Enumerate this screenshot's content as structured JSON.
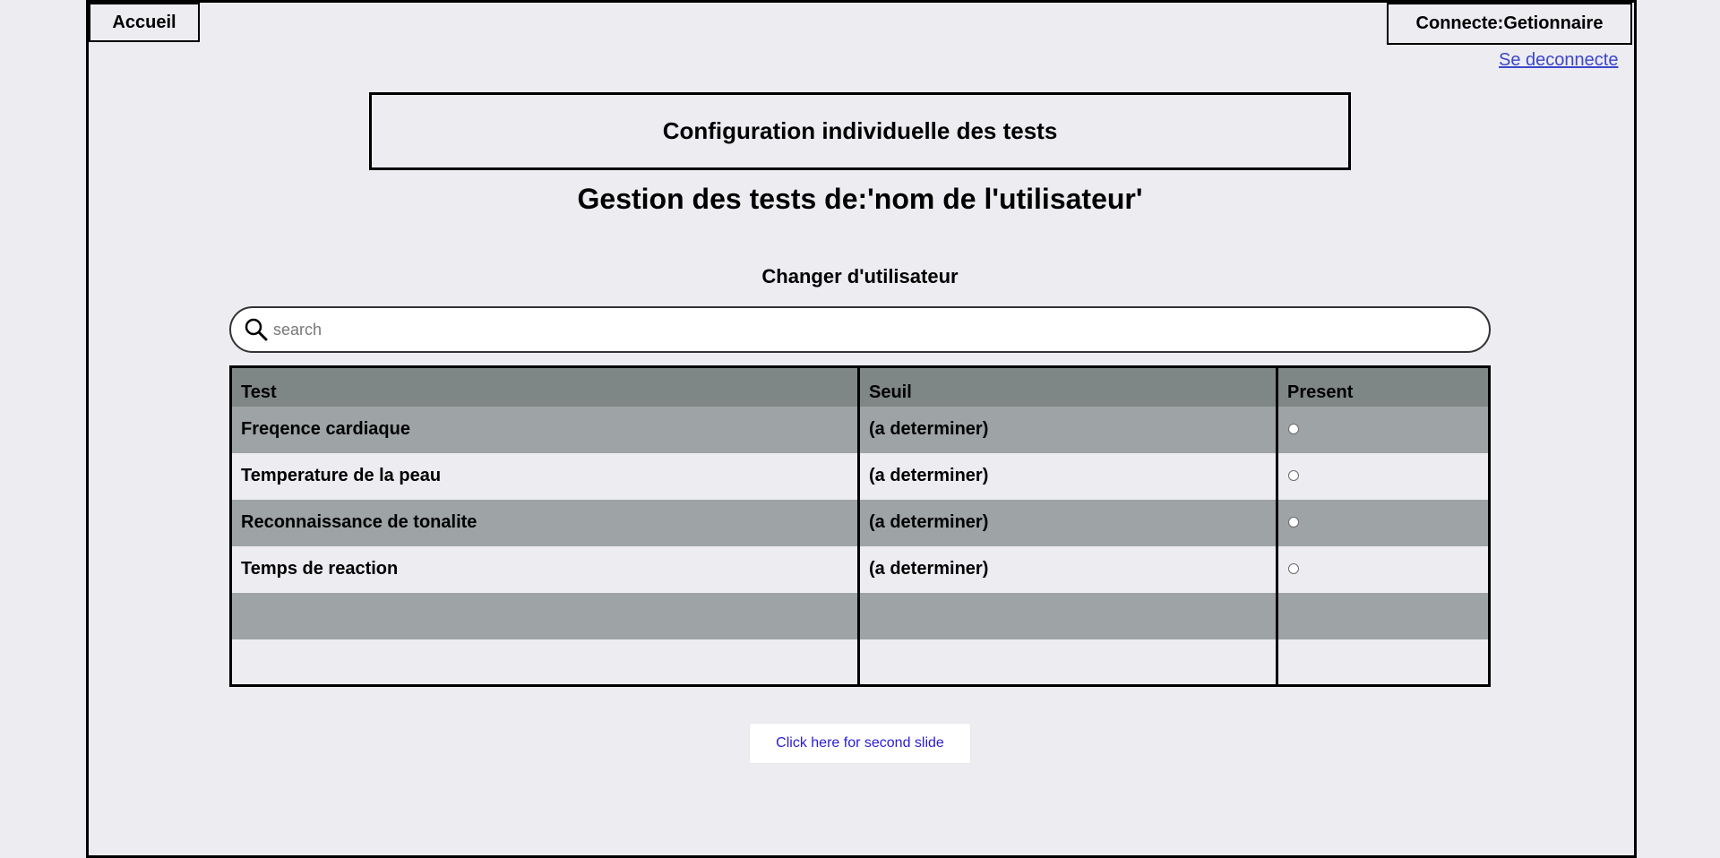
{
  "header": {
    "home_label": "Accueil",
    "user_label": "Connecte:Getionnaire",
    "logout_label": "Se deconnecte"
  },
  "main": {
    "config_title": "Configuration individuelle des tests",
    "page_title": "Gestion des tests de:'nom de l'utilisateur'",
    "change_user_label": "Changer d'utilisateur",
    "search_placeholder": "search",
    "search_value": ""
  },
  "table": {
    "headers": [
      "Test",
      "Seuil",
      "Present"
    ],
    "rows": [
      {
        "test": "Freqence cardiaque",
        "seuil": "(a determiner)",
        "present": false
      },
      {
        "test": "Temperature de la peau",
        "seuil": "(a determiner)",
        "present": false
      },
      {
        "test": "Reconnaissance de tonalite",
        "seuil": "(a determiner)",
        "present": false
      },
      {
        "test": "Temps de reaction",
        "seuil": "(a determiner)",
        "present": false
      },
      {
        "test": "",
        "seuil": "",
        "present": null
      },
      {
        "test": "",
        "seuil": "",
        "present": null
      }
    ]
  },
  "footer": {
    "slide_button_label": "Click here for second slide"
  },
  "colors": {
    "background": "#edecf1",
    "header_row": "#7f8786",
    "row_dark": "#9ea3a5",
    "link": "#3c47c9",
    "slide_button_text": "#2a1bd6"
  },
  "icons": {
    "search": "search-icon"
  }
}
